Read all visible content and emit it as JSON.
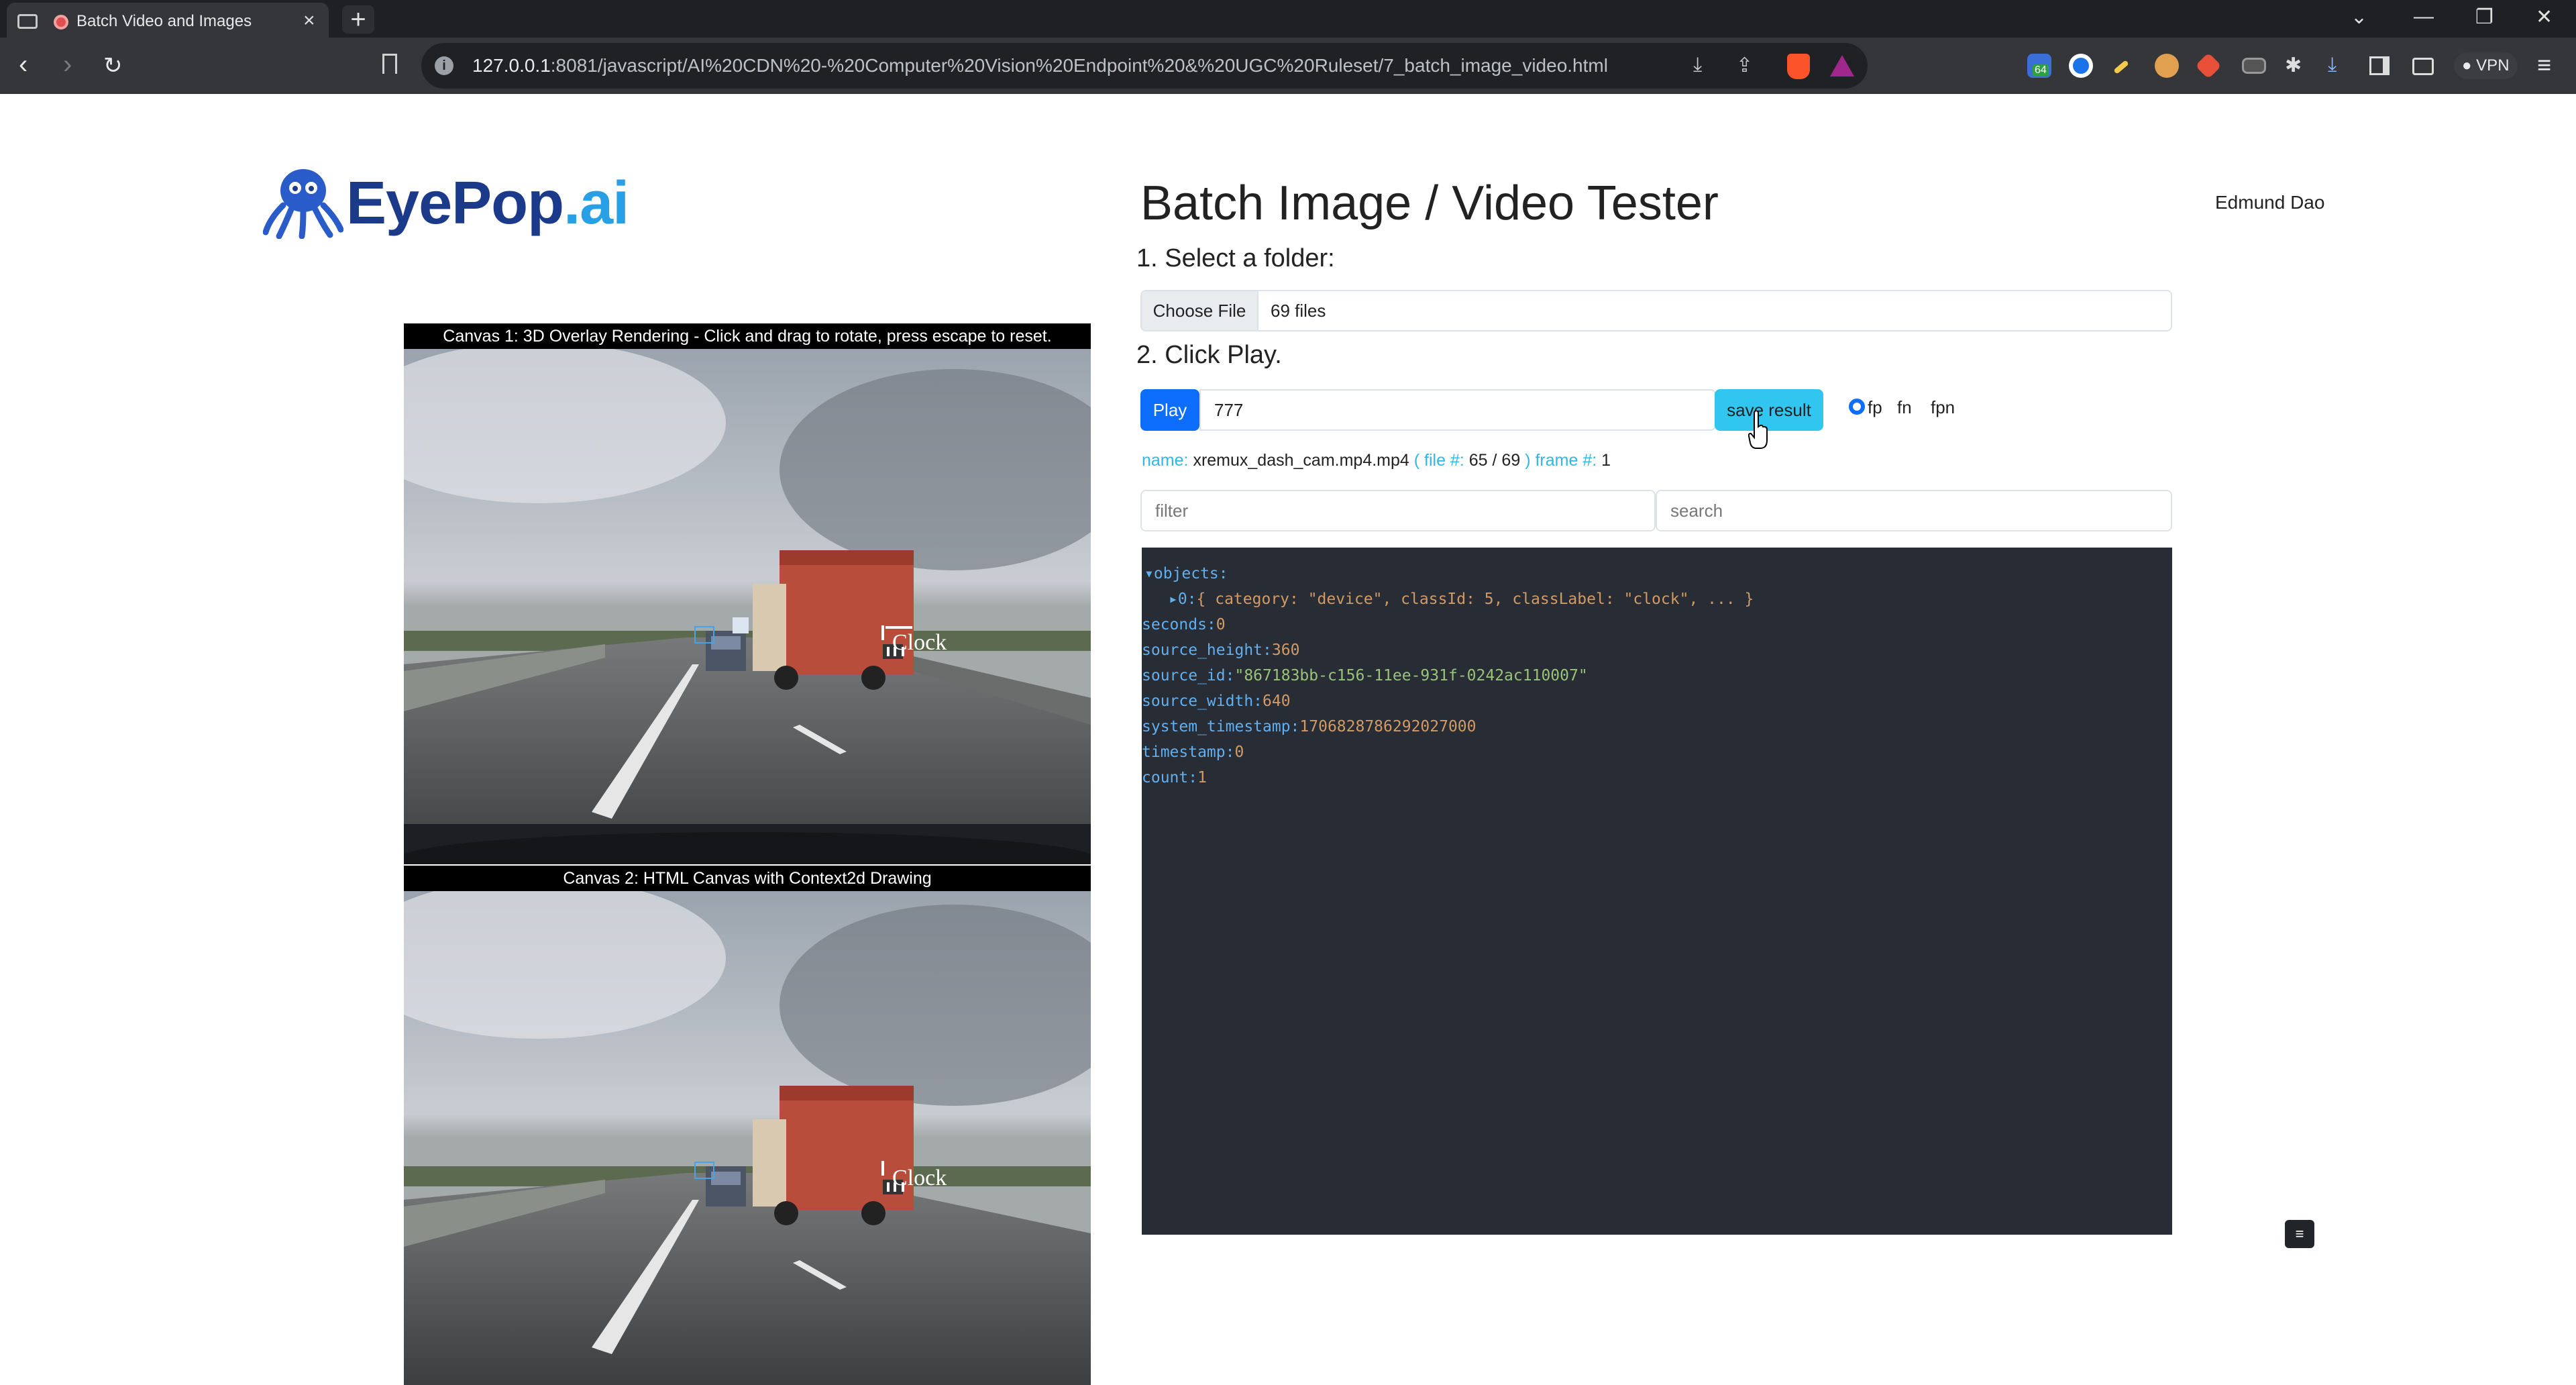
{
  "browser": {
    "tab_title": "Batch Video and Images",
    "url_host": "127.0.0.1",
    "url_rest": ":8081/javascript/AI%20CDN%20-%20Computer%20Vision%20Endpoint%20&%20UGC%20Ruleset/7_batch_image_video.html",
    "vpn_label": "VPN",
    "ext_badge": "64"
  },
  "brand": {
    "logo_main": "EyePop",
    "logo_suffix": ".ai"
  },
  "header": {
    "title": "Batch Image / Video Tester",
    "user": "Edmund Dao"
  },
  "steps": {
    "step1": "1. Select a folder:",
    "step2": "2. Click Play."
  },
  "file_picker": {
    "button": "Choose File",
    "value": "69 files"
  },
  "controls": {
    "play": "Play",
    "frame_value": "777",
    "save": "save result",
    "radios": [
      "fp",
      "fn",
      "fpn"
    ]
  },
  "info": {
    "name_label": "name:",
    "name_value": "xremux_dash_cam.mp4.mp4",
    "file_label_open": "( file #:",
    "file_current": "65",
    "file_sep": "/",
    "file_total": "69",
    "file_label_close": ")",
    "frame_label": "frame #:",
    "frame_value": "1"
  },
  "filters": {
    "filter_placeholder": "filter",
    "search_placeholder": "search"
  },
  "json_view": {
    "objects_key": "▾objects:",
    "item0_prefix": "▸0:",
    "item0_summary": "{ category: \"device\", classId: 5, classLabel: \"clock\", ... }",
    "fields": [
      {
        "key": "seconds:",
        "value": "0",
        "type": "num"
      },
      {
        "key": "source_height:",
        "value": "360",
        "type": "num"
      },
      {
        "key": "source_id:",
        "value": "\"867183bb-c156-11ee-931f-0242ac110007\"",
        "type": "str"
      },
      {
        "key": "source_width:",
        "value": "640",
        "type": "num"
      },
      {
        "key": "system_timestamp:",
        "value": "1706828786292027000",
        "type": "num"
      },
      {
        "key": "timestamp:",
        "value": "0",
        "type": "num"
      },
      {
        "key": "count:",
        "value": "1",
        "type": "num"
      }
    ]
  },
  "canvases": {
    "canvas1_title": "Canvas 1: 3D Overlay Rendering - Click and drag to rotate, press escape to reset.",
    "canvas2_title": "Canvas 2: HTML Canvas with Context2d Drawing",
    "detection_label": "Clock"
  },
  "fab_icon": "list-icon"
}
